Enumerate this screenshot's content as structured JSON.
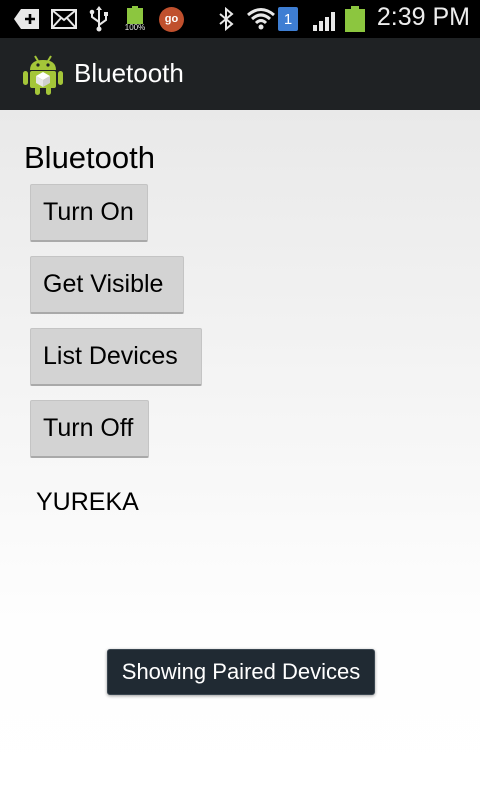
{
  "status_bar": {
    "time": "2:39 PM",
    "battery_small_label": "100%",
    "go_label": "go",
    "sim_label": "1",
    "icons": [
      "add-icon",
      "mail-icon",
      "usb-icon",
      "battery-100-icon",
      "go-app-icon",
      "bluetooth-icon",
      "wifi-icon",
      "sim-1-icon",
      "signal-icon",
      "battery-icon"
    ]
  },
  "action_bar": {
    "title": "Bluetooth",
    "icon": "android-app-icon"
  },
  "main": {
    "heading": "Bluetooth",
    "buttons": [
      "Turn On",
      "Get Visible",
      "List Devices",
      "Turn Off"
    ],
    "devices": [
      "YUREKA"
    ]
  },
  "toast": {
    "message": "Showing Paired Devices"
  },
  "colors": {
    "status_bar_bg": "#000000",
    "action_bar_bg": "#1f2224",
    "button_bg": "#d3d3d3",
    "toast_bg": "#202a33",
    "battery_green": "#8cc63f"
  }
}
